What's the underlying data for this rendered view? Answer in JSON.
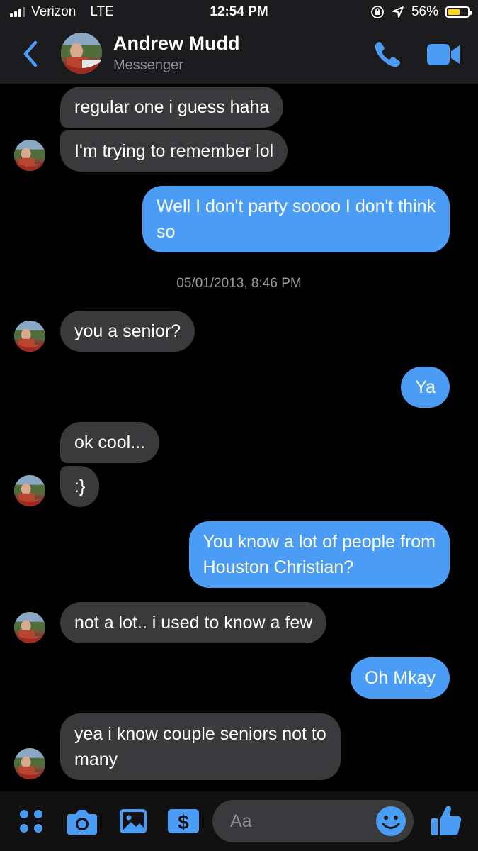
{
  "status": {
    "carrier": "Verizon",
    "network": "LTE",
    "time": "12:54 PM",
    "battery": "56%"
  },
  "header": {
    "name": "Andrew Mudd",
    "subtitle": "Messenger"
  },
  "messages": [
    {
      "dir": "in",
      "text": "regular one i guess haha"
    },
    {
      "dir": "in",
      "text": "I'm trying to remember lol"
    },
    {
      "dir": "out",
      "lines": [
        "Well I don't party soooo I don't think",
        "so"
      ]
    },
    {
      "dir": "in",
      "text": "you a senior?"
    },
    {
      "dir": "out",
      "text": "Ya"
    },
    {
      "dir": "in",
      "text": "ok cool..."
    },
    {
      "dir": "in",
      "text": ":}"
    },
    {
      "dir": "out",
      "lines": [
        "You know a lot of people from",
        "Houston Christian?"
      ]
    },
    {
      "dir": "in",
      "text": "not a lot.. i used to know a few"
    },
    {
      "dir": "out",
      "text": "Oh Mkay"
    },
    {
      "dir": "in",
      "lines": [
        "yea i know couple seniors not to",
        "many"
      ]
    }
  ],
  "timestamp": "05/01/2013, 8:46 PM",
  "composer": {
    "placeholder": "Aa"
  },
  "colors": {
    "accent": "#4a9cf4",
    "incoming": "#3a3a3c",
    "background": "#000000"
  }
}
